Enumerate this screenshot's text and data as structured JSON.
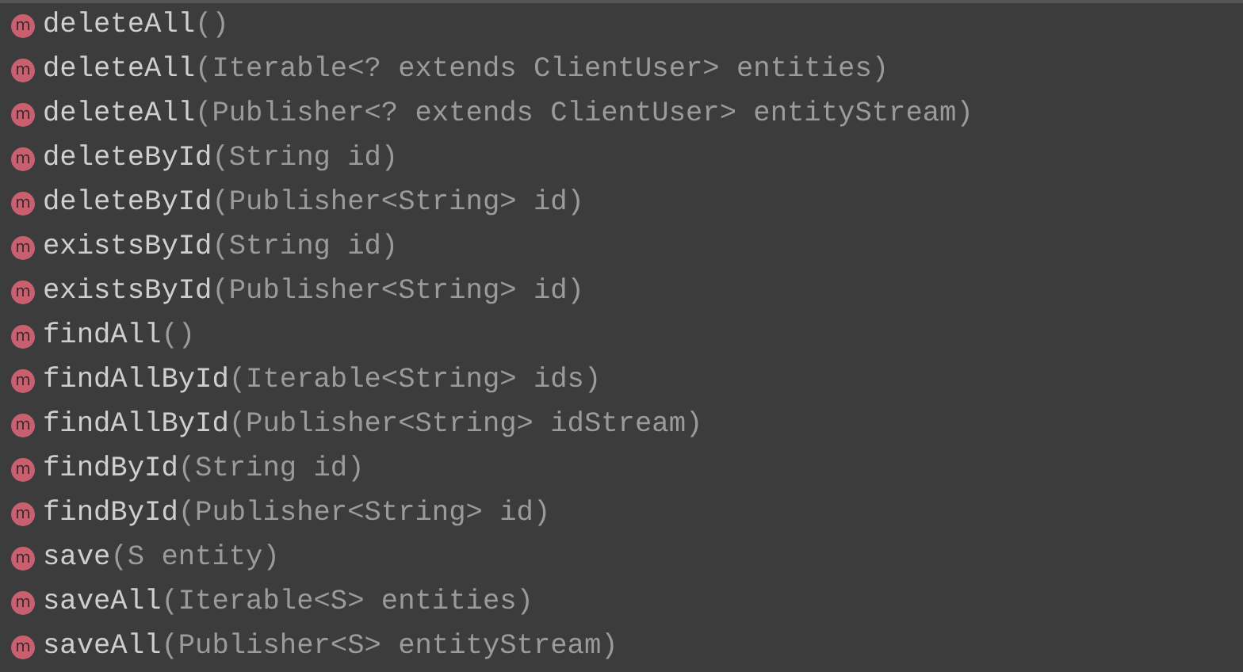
{
  "completion_list": {
    "items": [
      {
        "icon": "m",
        "name": "deleteAll",
        "params": "()"
      },
      {
        "icon": "m",
        "name": "deleteAll",
        "params": "(Iterable<? extends ClientUser> entities)"
      },
      {
        "icon": "m",
        "name": "deleteAll",
        "params": "(Publisher<? extends ClientUser> entityStream)"
      },
      {
        "icon": "m",
        "name": "deleteById",
        "params": "(String id)"
      },
      {
        "icon": "m",
        "name": "deleteById",
        "params": "(Publisher<String> id)"
      },
      {
        "icon": "m",
        "name": "existsById",
        "params": "(String id)"
      },
      {
        "icon": "m",
        "name": "existsById",
        "params": "(Publisher<String> id)"
      },
      {
        "icon": "m",
        "name": "findAll",
        "params": "()"
      },
      {
        "icon": "m",
        "name": "findAllById",
        "params": "(Iterable<String> ids)"
      },
      {
        "icon": "m",
        "name": "findAllById",
        "params": "(Publisher<String> idStream)"
      },
      {
        "icon": "m",
        "name": "findById",
        "params": "(String id)"
      },
      {
        "icon": "m",
        "name": "findById",
        "params": "(Publisher<String> id)"
      },
      {
        "icon": "m",
        "name": "save",
        "params": "(S entity)"
      },
      {
        "icon": "m",
        "name": "saveAll",
        "params": "(Iterable<S> entities)"
      },
      {
        "icon": "m",
        "name": "saveAll",
        "params": "(Publisher<S> entityStream)"
      }
    ]
  }
}
